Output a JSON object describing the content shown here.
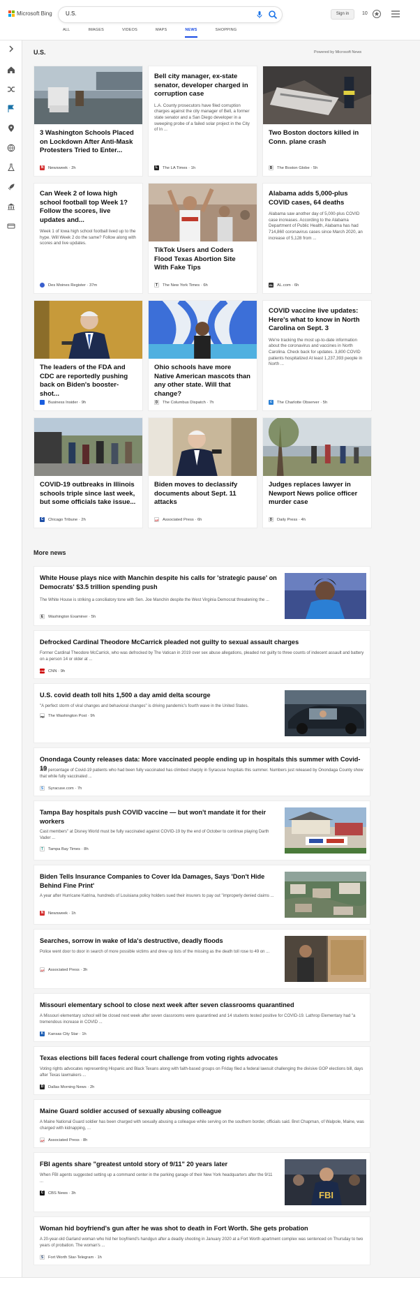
{
  "header": {
    "brand": "Microsoft Bing",
    "search_value": "U.S.",
    "signin": "Sign in",
    "points": "10",
    "tabs": [
      "ALL",
      "IMAGES",
      "VIDEOS",
      "MAPS",
      "NEWS",
      "SHOPPING"
    ],
    "active_tab": "NEWS",
    "accent_color": "#174ae4"
  },
  "section": {
    "title": "U.S.",
    "powered": "Powered by Microsoft News"
  },
  "cards": [
    {
      "title": "3 Washington Schools Placed on Lockdown After Anti-Mask Protesters Tried to Enter...",
      "source": "Newsweek",
      "age": "2h",
      "fav_color": "#d32f2f",
      "fav_text": "N"
    },
    {
      "title": "Bell city manager, ex-state senator, developer charged in corruption case",
      "snippet": "L.A. County prosecutors have filed corruption charges against the city manager of Bell, a former state senator and a San Diego developer in a sweeping probe of a failed solar project in the City of In ...",
      "source": "The LA Times",
      "age": "1h",
      "fav_color": "#222",
      "fav_text": "L"
    },
    {
      "title": "Two Boston doctors killed in Conn. plane crash",
      "source": "The Boston Globe",
      "age": "5h",
      "fav_color": "#fff",
      "fav_text": "B"
    },
    {
      "title": "Can Week 2 of Iowa high school football top Week 1? Follow the scores, live updates and...",
      "snippet": "Week 1 of Iowa high school football lived up to the hype. Will Week 2 do the same? Follow along with scores and live updates.",
      "source": "Des Moines Register",
      "age": "37m",
      "fav_color": "#3a5fcd",
      "fav_text": ""
    },
    {
      "title": "TikTok Users and Coders Flood Texas Abortion Site With Fake Tips",
      "source": "The New York Times",
      "age": "6h",
      "fav_color": "#fff",
      "fav_text": "T"
    },
    {
      "title": "Alabama adds 5,000-plus COVID cases, 64 deaths",
      "snippet": "Alabama saw another day of 5,000-plus COVID case increases. According to the Alabama Department of Public Health, Alabama has had 714,860 coronavirus cases since March 2020, an increase of 5,128 from ...",
      "source": "AL.com",
      "age": "6h",
      "fav_color": "#333",
      "fav_text": "AL"
    },
    {
      "title": "The leaders of the FDA and CDC are reportedly pushing back on Biden's booster-shot...",
      "source": "Business Insider",
      "age": "9h",
      "fav_color": "#1a5dde",
      "fav_text": ""
    },
    {
      "title": "Ohio schools have more Native American mascots than any other state. Will that change?",
      "source": "The Columbus Dispatch",
      "age": "7h",
      "fav_color": "#fff",
      "fav_text": "D"
    },
    {
      "title": "COVID vaccine live updates: Here's what to know in North Carolina on Sept. 3",
      "snippet": "We're tracking the most up-to-date information about the coronavirus and vaccines in North Carolina. Check back for updates. 3,800 COVID patients hospitalized At least 1,237,393 people in North ...",
      "source": "The Charlotte Observer",
      "age": "5h",
      "fav_color": "#2a7fd4",
      "fav_text": "c"
    },
    {
      "title": "COVID-19 outbreaks in Illinois schools triple since last week, but some officials take issue...",
      "source": "Chicago Tribune",
      "age": "2h",
      "fav_color": "#1d4ea6",
      "fav_text": "C"
    },
    {
      "title": "Biden moves to declassify documents about Sept. 11 attacks",
      "source": "Associated Press",
      "age": "6h",
      "fav_color": "#fff",
      "fav_text": "AP"
    },
    {
      "title": "Judges replaces lawyer in Newport News police officer murder case",
      "source": "Daily Press",
      "age": "4h",
      "fav_color": "#fff",
      "fav_text": "D"
    }
  ],
  "more_news": {
    "title": "More news",
    "items": [
      {
        "title": "White House plays nice with Manchin despite his calls for 'strategic pause' on Democrats' $3.5 trillion spending push",
        "snippet": "The White House is striking a conciliatory tone with Sen. Joe Manchin despite the West Virginia Democrat threatening the ...",
        "source": "Washington Examiner",
        "age": "5h"
      },
      {
        "title": "Defrocked Cardinal Theodore McCarrick pleaded not guilty to sexual assault charges",
        "snippet": "Former Cardinal Theodore McCarrick, who was defrocked by The Vatican in 2019 over sex abuse allegations, pleaded not guilty to three counts of indecent assault and battery on a person 14 or older at ...",
        "source": "CNN",
        "age": "9h"
      },
      {
        "title": "U.S. covid death toll hits 1,500 a day amid delta scourge",
        "snippet": "\"A perfect storm of viral changes and behavioral changes\" is driving pandemic's fourth wave in the United States.",
        "source": "The Washington Post",
        "age": "9h"
      },
      {
        "title": "Onondaga County releases data: More vaccinated people ending up in hospitals this summer with Covid-19",
        "snippet": "The percentage of Covid-19 patients who had been fully vaccinated has climbed sharply in Syracuse hospitals this summer. Numbers just released by Onondaga County show that while fully vaccinated ...",
        "source": "Syracuse.com",
        "age": "7h"
      },
      {
        "title": "Tampa Bay hospitals push COVID vaccine — but won't mandate it for their workers",
        "snippet": "Cast members\" at Disney World must be fully vaccinated against COVID-19 by the end of October to continue playing Darth Vader ...",
        "source": "Tampa Bay Times",
        "age": "8h"
      },
      {
        "title": "Biden Tells Insurance Companies to Cover Ida Damages, Says 'Don't Hide Behind Fine Print'",
        "snippet": "A year after Hurricane Katrina, hundreds of Louisiana policy holders sued their insurers to pay out \"improperly denied claims ...",
        "source": "Newsweek",
        "age": "1h"
      },
      {
        "title": "Searches, sorrow in wake of Ida's destructive, deadly floods",
        "snippet": "Police went door to door in search of more possible victims and drew up lists of the missing as the death toll rose to 49 on ...",
        "source": "Associated Press",
        "age": "3h"
      },
      {
        "title": "Missouri elementary school to close next week after seven classrooms quarantined",
        "snippet": "A Missouri elementary school will be closed next week after seven classrooms were quarantined and 14 students tested positive for COVID-19. Lathrop Elementary had \"a tremendous increase in COVID ...",
        "source": "Kansas City Star",
        "age": "1h"
      },
      {
        "title": "Texas elections bill faces federal court challenge from voting rights advocates",
        "snippet": "Voting rights advocates representing Hispanic and Black Texans along with faith-based groups on Friday filed a federal lawsuit challenging the divisive GOP elections bill, days after Texas lawmakers ...",
        "source": "Dallas Morning News",
        "age": "2h"
      },
      {
        "title": "Maine Guard soldier accused of sexually abusing colleague",
        "snippet": "A Maine National Guard soldier has been charged with sexually abusing a colleague while serving on the southern border, officials said. Bret Chapman, of Walpole, Maine, was charged with kidnapping, ...",
        "source": "Associated Press",
        "age": "8h"
      },
      {
        "title": "FBI agents share \"greatest untold story of 9/11\" 20 years later",
        "snippet": "When FBI agents suggested setting up a command center in the parking garage of their New York headquarters after the 9/11 ...",
        "source": "CBS News",
        "age": "3h"
      },
      {
        "title": "Woman hid boyfriend's gun after he was shot to death in Fort Worth. She gets probation",
        "snippet": "A 20-year-old Garland woman who hid her boyfriend's handgun after a deadly shooting in January 2020 at a Fort Worth apartment complex was sentenced on Thursday to two years of probation. The woman's ...",
        "source": "Fort Worth Star-Telegram",
        "age": "1h"
      }
    ]
  }
}
